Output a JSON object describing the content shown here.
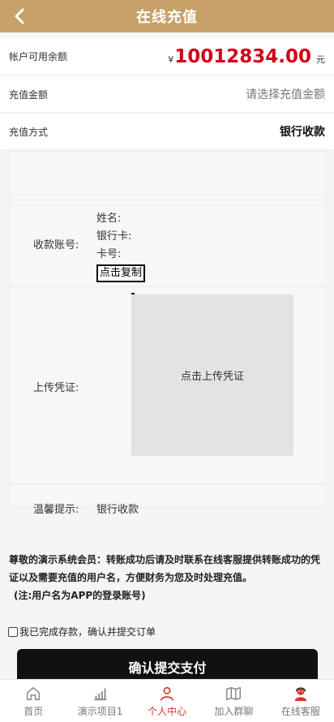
{
  "header": {
    "title": "在线充值",
    "back_icon": "chevron-left-icon"
  },
  "balance": {
    "label": "帐户可用余额",
    "currency": "¥",
    "amount": "10012834.00",
    "unit": "元"
  },
  "recharge_amount": {
    "label": "充值金额",
    "placeholder": "请选择充值金额"
  },
  "method": {
    "label": "充值方式",
    "value": "银行收款"
  },
  "receive_account": {
    "label": "收款账号:",
    "name_label": "姓名:",
    "bank_label": "银行卡:",
    "card_label": "卡号:",
    "copy_label": "点击复制"
  },
  "upload": {
    "label": "上传凭证:",
    "button_text": "点击上传凭证"
  },
  "tip": {
    "label": "温馨提示:",
    "value": "银行收款"
  },
  "notice": {
    "line1": "尊敬的演示系统会员：转账成功后请及时联系在线客服提供转账成功的凭",
    "line2": "证以及需要充值的用户名，方便财务为您及时处理充值。",
    "line3": "(注:用户名为APP的登录账号)"
  },
  "agree_text": "我已完成存款，确认并提交订单",
  "submit_label": "确认提交支付",
  "tabs": [
    {
      "label": "首页",
      "icon": "home-icon",
      "active": false
    },
    {
      "label": "演示项目1",
      "icon": "bar-chart-icon",
      "active": false
    },
    {
      "label": "个人中心",
      "icon": "person-icon",
      "active": true
    },
    {
      "label": "加入群聊",
      "icon": "map-icon",
      "active": false
    },
    {
      "label": "在线客服",
      "icon": "customer-service-icon",
      "active": false
    }
  ],
  "colors": {
    "header_bg": "#c8a16a",
    "amount_red": "#d2001a",
    "active_tab": "#d9332b",
    "submit_bg": "#111111"
  }
}
